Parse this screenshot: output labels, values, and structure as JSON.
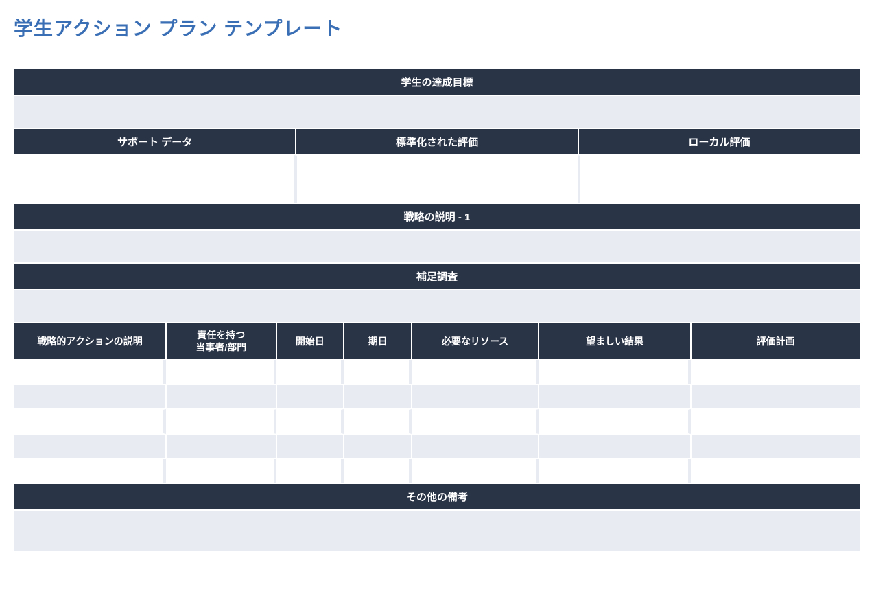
{
  "title": "学生アクション プラン テンプレート",
  "sections": {
    "goal_header": "学生の達成目標",
    "support_cols": {
      "col1": "サポート データ",
      "col2": "標準化された評価",
      "col3": "ローカル評価"
    },
    "strategy_header": "戦略の説明 - 1",
    "supplement_header": "補足調査",
    "action_headers": {
      "h1": "戦略的アクションの説明",
      "h2": "責任を持つ\n当事者/部門",
      "h3": "開始日",
      "h4": "期日",
      "h5": "必要なリソース",
      "h6": "望ましい結果",
      "h7": "評価計画"
    },
    "notes_header": "その他の備考"
  }
}
